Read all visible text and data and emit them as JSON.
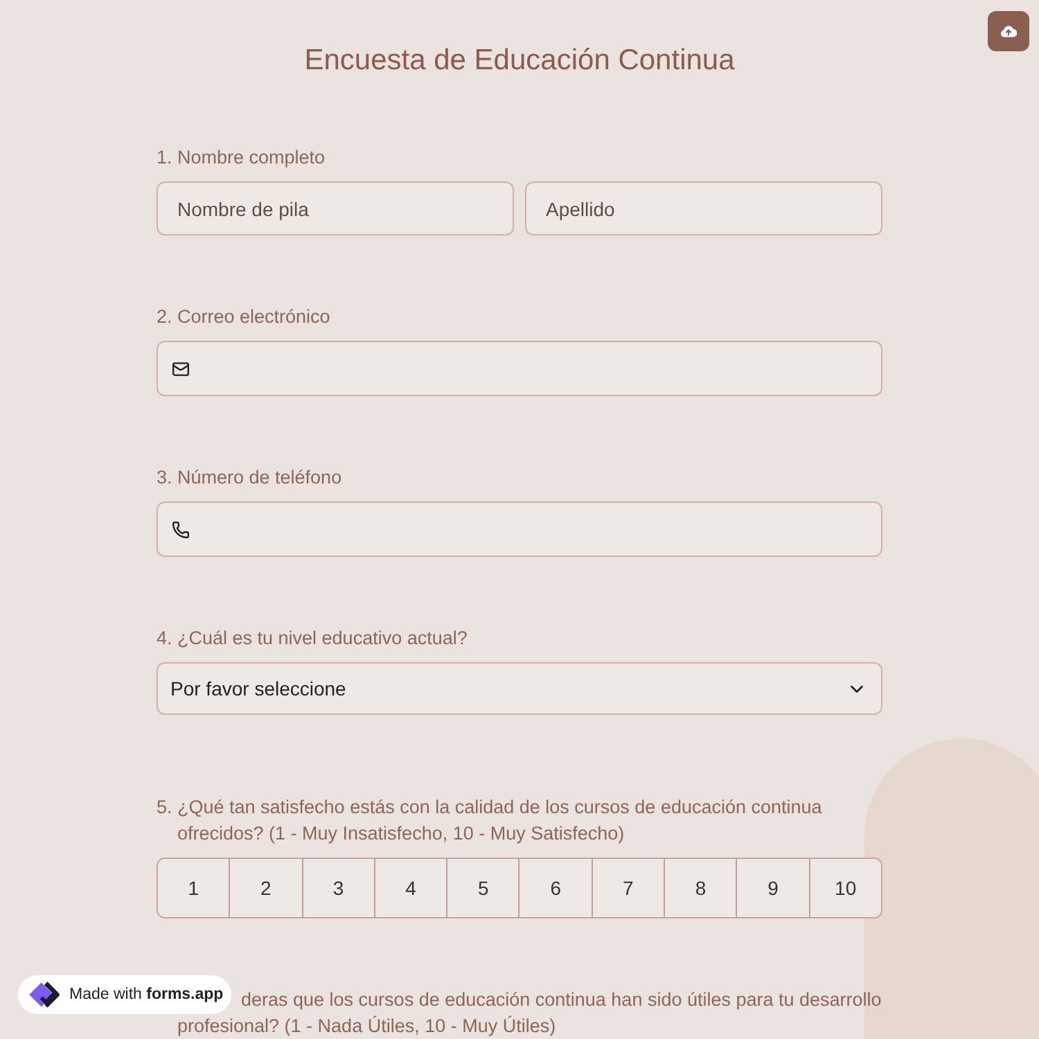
{
  "title": "Encuesta de Educación Continua",
  "questions": [
    {
      "kind": "name",
      "number": "1.",
      "label": "Nombre completo",
      "fields": [
        {
          "placeholder": "Nombre de pila"
        },
        {
          "placeholder": "Apellido"
        }
      ]
    },
    {
      "kind": "email",
      "number": "2.",
      "label": "Correo electrónico"
    },
    {
      "kind": "phone",
      "number": "3.",
      "label": "Número de teléfono"
    },
    {
      "kind": "dropdown",
      "number": "4.",
      "label": "¿Cuál es tu nivel educativo actual?",
      "placeholder": "Por favor seleccione"
    },
    {
      "kind": "rating",
      "number": "5.",
      "label": "¿Qué tan satisfecho estás con la calidad de los cursos de educación continua ofrecidos? (1 - Muy Insatisfecho, 10 - Muy Satisfecho)",
      "options": [
        {
          "label": "1",
          "selected": false
        },
        {
          "label": "2",
          "selected": false
        },
        {
          "label": "3",
          "selected": false
        },
        {
          "label": "4",
          "selected": false
        },
        {
          "label": "5",
          "selected": false
        },
        {
          "label": "6",
          "selected": false
        },
        {
          "label": "7",
          "selected": false
        },
        {
          "label": "8",
          "selected": false
        },
        {
          "label": "9",
          "selected": false
        },
        {
          "label": "10",
          "selected": false
        }
      ]
    },
    {
      "kind": "rating",
      "label_lines": [
        "deras que los cursos de educación continua han sido útiles para tu desarrollo",
        "profesional? (1 - Nada Útiles, 10 - Muy Útiles)"
      ]
    }
  ],
  "badge": {
    "text": "Made with **forms.app**"
  }
}
